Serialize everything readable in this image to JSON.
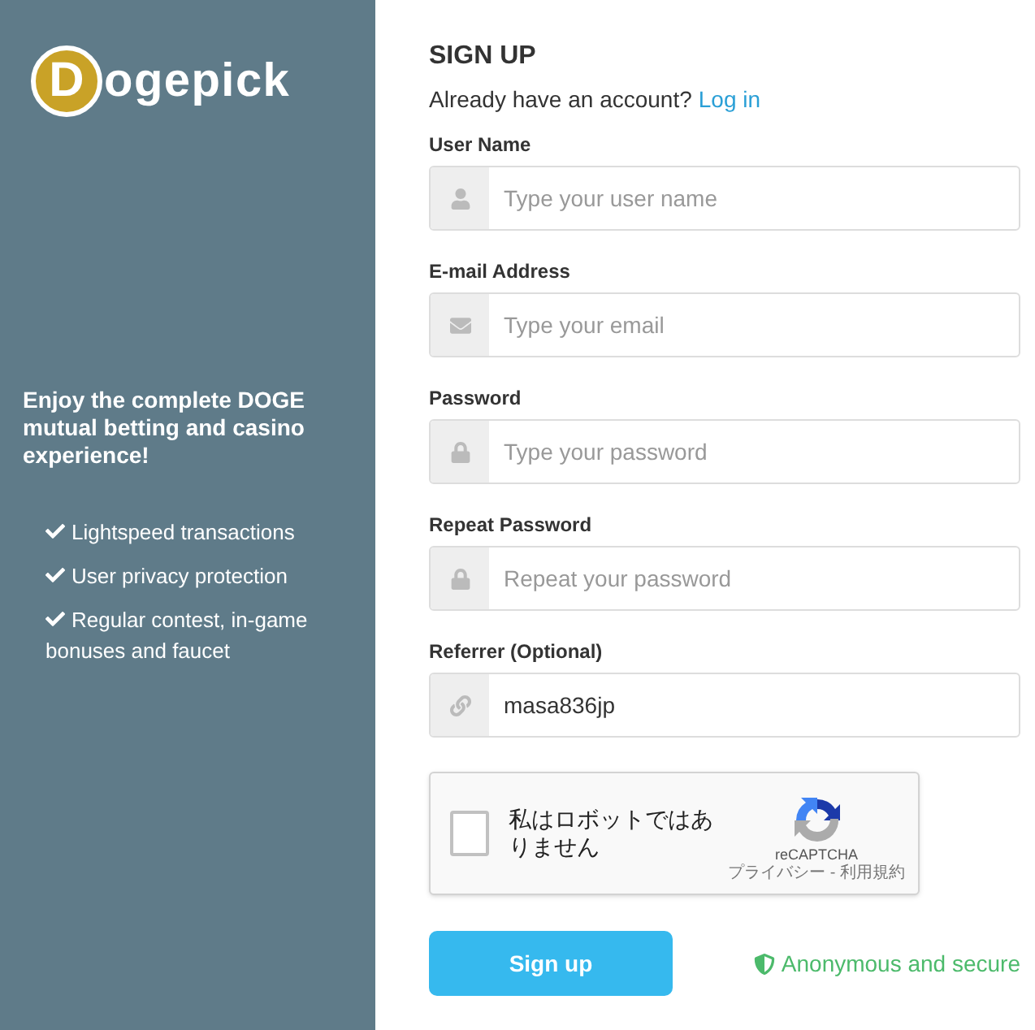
{
  "sidebar": {
    "logo": {
      "initial": "D",
      "rest": "ogepick"
    },
    "tagline": "Enjoy the complete DOGE mutual betting and casino experience!",
    "features": [
      "Lightspeed transactions",
      "User privacy protection",
      "Regular contest, in-game bonuses and faucet"
    ]
  },
  "form": {
    "title": "SIGN UP",
    "account_prompt": "Already have an account?",
    "login_link": "Log in",
    "fields": [
      {
        "label": "User Name",
        "kind": "user",
        "placeholder": "Type your user name"
      },
      {
        "label": "E-mail Address",
        "kind": "email",
        "placeholder": "Type your email"
      },
      {
        "label": "Password",
        "kind": "lock",
        "placeholder": "Type your password"
      },
      {
        "label": "Repeat Password",
        "kind": "lock",
        "placeholder": "Repeat your password"
      },
      {
        "label": "Referrer (Optional)",
        "kind": "link",
        "value": "masa836jp"
      }
    ],
    "captcha": {
      "checked": false,
      "label": "私はロボットではありません",
      "brand": "reCAPTCHA",
      "links": "プライバシー - 利用規約"
    },
    "submit": "Sign up",
    "security_note": "Anonymous and secure"
  }
}
